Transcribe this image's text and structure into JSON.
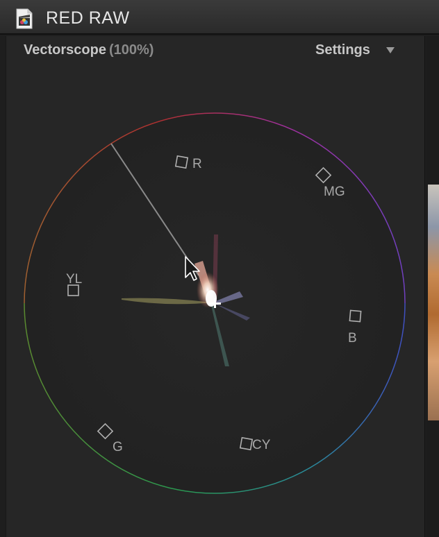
{
  "window": {
    "title": "RED RAW",
    "app_icon": "final-cut-clapper-icon"
  },
  "panel": {
    "name": "Vectorscope",
    "zoom": "(100%)",
    "settings_label": "Settings",
    "settings_icon": "caret-down-icon"
  },
  "vectorscope": {
    "targets": [
      {
        "label": "R"
      },
      {
        "label": "MG"
      },
      {
        "label": "B"
      },
      {
        "label": "CY"
      },
      {
        "label": "G"
      },
      {
        "label": "YL"
      }
    ],
    "colors": {
      "red": "#c0392b",
      "magenta": "#b03ac0",
      "blue": "#4a5ad0",
      "cyan": "#2aa0a0",
      "green": "#3ca040",
      "yellow": "#b0a030"
    }
  }
}
